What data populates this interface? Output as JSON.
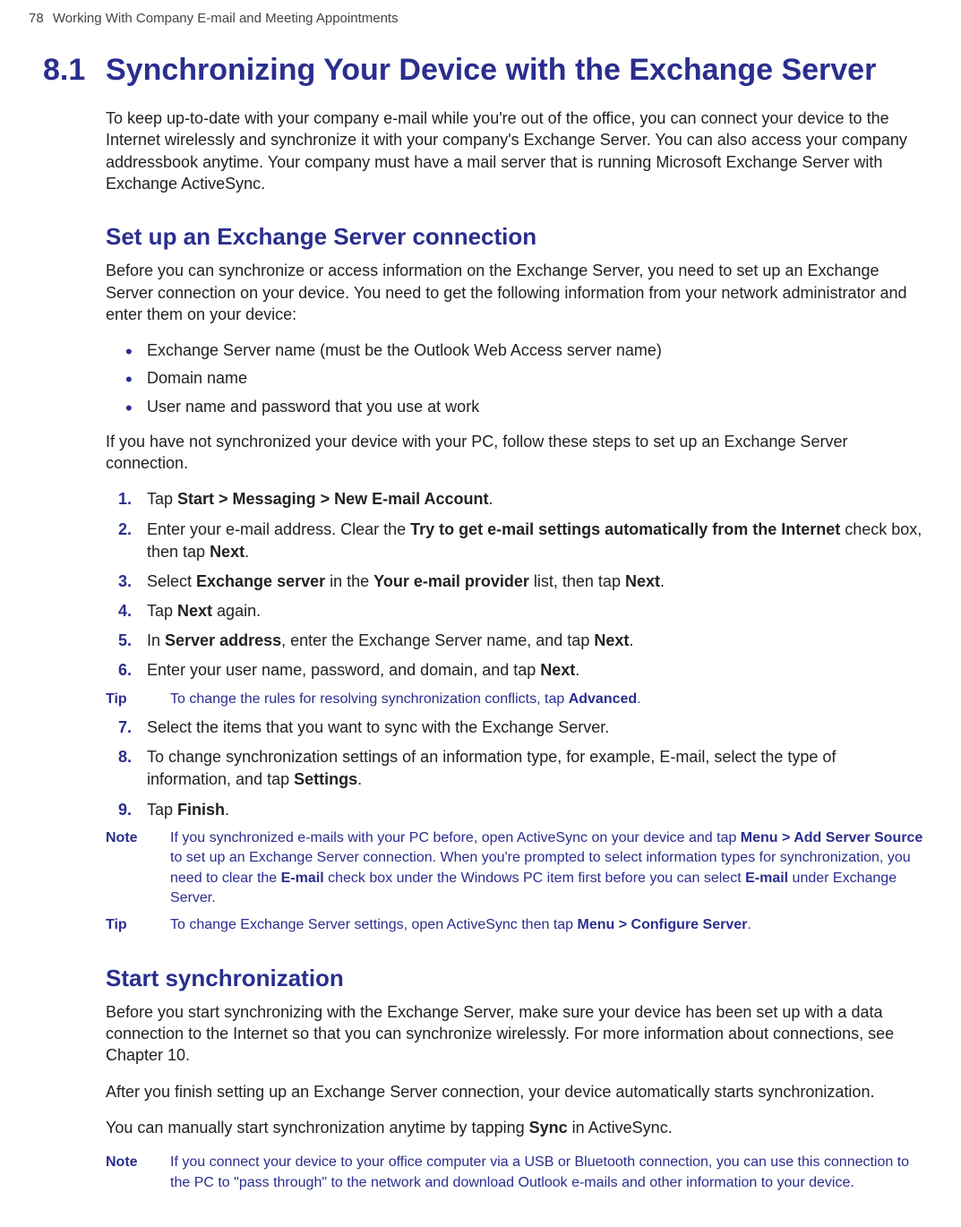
{
  "header": {
    "page_number": "78",
    "running_title": "Working With Company E-mail and Meeting Appointments"
  },
  "section": {
    "num": "8.1",
    "title": "Synchronizing Your Device with the Exchange Server",
    "intro": "To keep up-to-date with your company e-mail while you're out of the office, you can connect your device to the Internet wirelessly and synchronize it with your company's Exchange Server. You can also access your company addressbook anytime. Your company must have a mail server that is running Microsoft Exchange Server with Exchange ActiveSync."
  },
  "setup": {
    "heading": "Set up an Exchange Server connection",
    "p1": "Before you can synchronize or access information on the Exchange Server, you need to set up an Exchange Server connection on your device. You need to get the following information from your network administrator and enter them on your device:",
    "bullets": [
      "Exchange Server name (must be the Outlook Web Access server name)",
      "Domain name",
      "User name and password that you use at work"
    ],
    "p2": "If you have not synchronized your device with your PC, follow these steps to set up an Exchange Server connection.",
    "steps_a": {
      "s1": {
        "num": "1.",
        "pre": "Tap ",
        "bold": "Start > Messaging > New E-mail Account",
        "post": "."
      },
      "s2": {
        "num": "2.",
        "pre": "Enter your e-mail address. Clear the ",
        "bold1": "Try to get e-mail settings automatically from the Internet",
        "mid": " check box, then tap ",
        "bold2": "Next",
        "post": "."
      },
      "s3": {
        "num": "3.",
        "pre": "Select ",
        "bold1": "Exchange server",
        "mid1": " in the ",
        "bold2": "Your e-mail provider",
        "mid2": " list, then tap ",
        "bold3": "Next",
        "post": "."
      },
      "s4": {
        "num": "4.",
        "pre": "Tap ",
        "bold": "Next",
        "post": " again."
      },
      "s5": {
        "num": "5.",
        "pre": "In ",
        "bold1": "Server address",
        "mid": ", enter the Exchange Server name, and tap ",
        "bold2": "Next",
        "post": "."
      },
      "s6": {
        "num": "6.",
        "pre": "Enter your user name, password, and domain, and tap ",
        "bold": "Next",
        "post": "."
      }
    },
    "tip1": {
      "label": "Tip",
      "pre": "To change the rules for resolving synchronization conflicts, tap ",
      "bold": "Advanced",
      "post": "."
    },
    "steps_b": {
      "s7": {
        "num": "7.",
        "text": "Select the items that you want to sync with the Exchange Server."
      },
      "s8": {
        "num": "8.",
        "pre": "To change synchronization settings of an information type, for example, E-mail, select the type of information, and tap ",
        "bold": "Settings",
        "post": "."
      },
      "s9": {
        "num": "9.",
        "pre": "Tap ",
        "bold": "Finish",
        "post": "."
      }
    },
    "note1": {
      "label": "Note",
      "pre": "If you synchronized e-mails with your PC before, open ActiveSync on your device and tap ",
      "bold1": "Menu > Add Server Source",
      "mid1": " to set up an Exchange Server connection. When you're prompted to select information types for synchronization, you need to clear the ",
      "bold2": "E-mail",
      "mid2": " check box under the Windows PC item first before you can select ",
      "bold3": "E-mail",
      "post": " under Exchange Server."
    },
    "tip2": {
      "label": "Tip",
      "pre": "To change Exchange Server settings, open ActiveSync then tap ",
      "bold": "Menu > Configure Server",
      "post": "."
    }
  },
  "startsync": {
    "heading": "Start synchronization",
    "p1": "Before you start synchronizing with the Exchange Server, make sure your device has been set up with a data connection to the Internet so that you can synchronize wirelessly. For more information about connections, see Chapter 10.",
    "p2": "After you finish setting up an Exchange Server connection, your device automatically starts synchronization.",
    "p3_pre": "You can manually start synchronization anytime by tapping ",
    "p3_bold": "Sync",
    "p3_post": " in ActiveSync.",
    "note": {
      "label": "Note",
      "text": "If you connect your device to your office computer via a USB or Bluetooth connection, you can use this connection to the PC to \"pass through\" to the network and download Outlook e-mails and other information to your device."
    }
  }
}
